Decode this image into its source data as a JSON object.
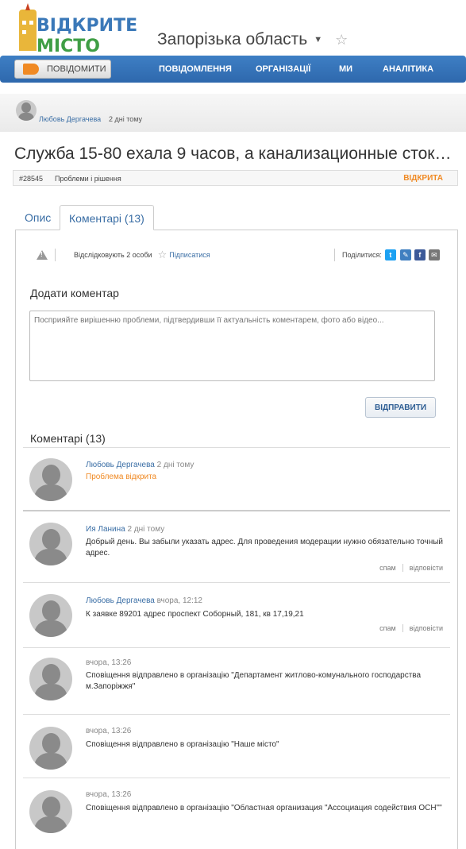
{
  "logo": {
    "line1": "ВІДКРИТЕ",
    "line2": "МІСТО"
  },
  "header": {
    "region": "Запорізька область",
    "caret_icon": "caret-down-icon",
    "star_icon": "star-outline-icon"
  },
  "nav": {
    "report_label": "ПОВІДОМИТИ",
    "report_icon": "megaphone-icon",
    "items": [
      "ПОВІДОМЛЕННЯ",
      "ОРГАНІЗАЦІЇ",
      "МИ",
      "АНАЛІТИКА"
    ]
  },
  "author": {
    "name": "Любовь Дергачева",
    "time": "2 дні тому"
  },
  "problem": {
    "title": "Служба 15-80 exaла 9 часов, а канализационные стоки …",
    "id": "#28545",
    "category": "Проблеми і рішення",
    "status": "ВІДКРИТА"
  },
  "tabs": {
    "description": "Опис",
    "comments": "Коментарі (13)"
  },
  "toolbar": {
    "followers": "Відслідковують 2 особи",
    "subscribe": "Підписатися",
    "share_label": "Поділитися:",
    "share_icons": [
      "twitter-icon",
      "vk-icon",
      "facebook-icon",
      "email-icon"
    ],
    "colors": {
      "twitter": "#1da1f2",
      "vk": "#3f7fc0",
      "facebook": "#3b5998",
      "email": "#777777"
    }
  },
  "add_comment": {
    "title": "Додати коментар",
    "placeholder": "Посприяйте вирішенню проблеми, підтвердивши її актуальність коментарем, фото або відео...",
    "submit": "ВІДПРАВИТИ"
  },
  "comments_title": "Коментарі (13)",
  "actions": {
    "spam": "спам",
    "reply": "відповісти"
  },
  "comments": [
    {
      "name": "Любовь Дергачева",
      "time": "2 дні тому",
      "status": "Проблема відкрита"
    },
    {
      "name": "Ия Ланина",
      "time": "2 дні тому",
      "text": "Добрый день. Вы забыли указать адрес. Для проведения модерации нужно обязательно точный адрес."
    },
    {
      "name": "Любовь Дергачева",
      "time": "вчора, 12:12",
      "text": "К заявке 89201 адрес проспект Соборный, 181, кв 17,19,21"
    },
    {
      "name": "",
      "time": "вчора, 13:26",
      "text": "Сповіщення відправлено в організацію \"Департамент житлово-комунального господарства м.Запоріжжя\""
    },
    {
      "name": "",
      "time": "вчора, 13:26",
      "text": "Сповіщення відправлено в організацію \"Наше місто\""
    },
    {
      "name": "",
      "time": "вчора, 13:26",
      "text": "Сповіщення відправлено в організацію \"Областная организация \"Ассоциация содействия ОСН\"\""
    }
  ]
}
